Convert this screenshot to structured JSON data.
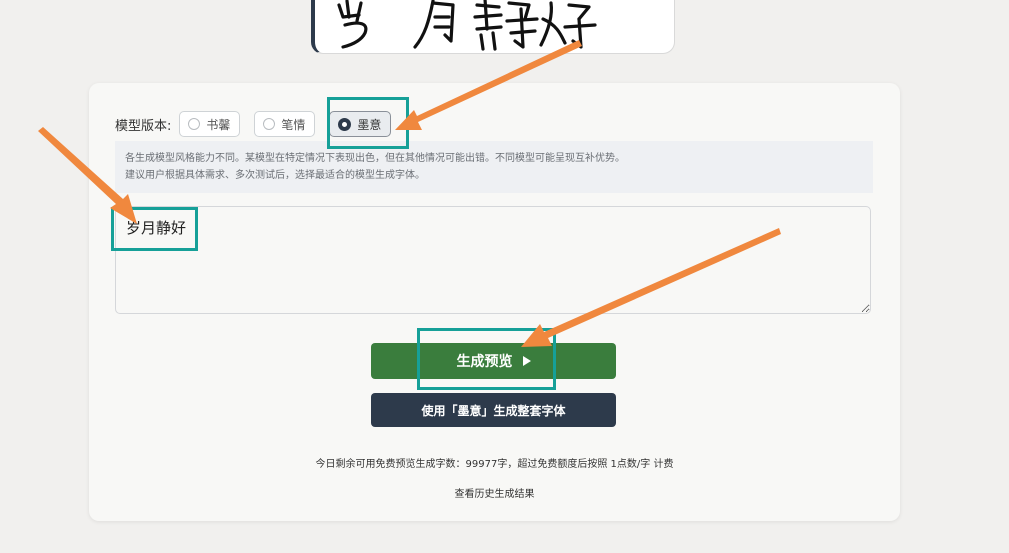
{
  "preview": {
    "sample_text": "岁月静好"
  },
  "model": {
    "label": "模型版本:",
    "options": [
      {
        "label": "书馨",
        "selected": false
      },
      {
        "label": "笔情",
        "selected": false
      },
      {
        "label": "墨意",
        "selected": true
      }
    ]
  },
  "hint": {
    "line1": "各生成模型风格能力不同。某模型在特定情况下表现出色，但在其他情况可能出错。不同模型可能呈现互补优势。",
    "line2": "建议用户根据具体需求、多次测试后，选择最适合的模型生成字体。"
  },
  "input": {
    "value": "岁月静好"
  },
  "buttons": {
    "preview_label": "生成预览",
    "full_label": "使用「墨意」生成整套字体"
  },
  "quota_text": "今日剩余可用免费预览生成字数：99977字，超过免费额度后按照 1点数/字 计费",
  "history_link": "查看历史生成结果",
  "colors": {
    "accent_green": "#3a7d3d",
    "dark": "#2d3a4b",
    "highlight": "#16a098",
    "arrow": "#f0883e"
  }
}
